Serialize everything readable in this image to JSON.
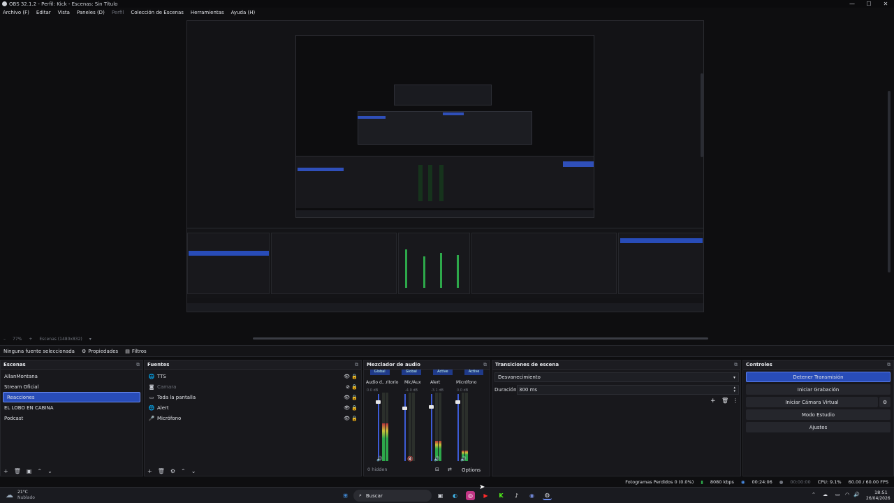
{
  "window": {
    "title": "OBS 32.1.2 - Perfil: Kick - Escenas: Sin Título"
  },
  "menu": [
    "Archivo (F)",
    "Editar",
    "Vista",
    "Paneles (D)",
    "Perfil",
    "Colección de Escenas",
    "Herramientas",
    "Ayuda (H)"
  ],
  "zoom": {
    "percent": "77%",
    "scale_label": "Escenas (1480x832)"
  },
  "source_bar": {
    "no_source": "Ninguna fuente seleccionada",
    "properties": "Propiedades",
    "filters": "Filtros"
  },
  "scenes": {
    "title": "Escenas",
    "items": [
      "AllanMontana",
      "Stream Oficial",
      "Reacciones",
      "EL LOBO EN CABINA",
      "Podcast"
    ],
    "selected": "Reacciones"
  },
  "sources": {
    "title": "Fuentes",
    "items": [
      {
        "name": "TTS",
        "icon": "globe-icon"
      },
      {
        "name": "Camara",
        "icon": "camera-icon"
      },
      {
        "name": "Toda la pantalla",
        "icon": "monitor-icon"
      },
      {
        "name": "Alert",
        "icon": "globe-icon"
      },
      {
        "name": "Micrófono",
        "icon": "mic-icon"
      }
    ]
  },
  "mixer": {
    "title": "Mezclador de audio",
    "tabs": [
      "Global",
      "Global",
      "Active",
      "Active"
    ],
    "channels": [
      {
        "name": "Audio d...ritorio",
        "db": "0.0 dB",
        "level": 0.55,
        "fader": 0.9
      },
      {
        "name": "Mic/Aux",
        "db": "-4.0 dB",
        "level": 0.0,
        "fader": 0.8
      },
      {
        "name": "Alert",
        "db": "-3.1 dB",
        "level": 0.3,
        "fader": 0.82
      },
      {
        "name": "Micrófono",
        "db": "0.0 dB",
        "level": 0.15,
        "fader": 0.9
      }
    ],
    "hidden": "0 hidden",
    "options": "Options"
  },
  "transitions": {
    "title": "Transiciones de escena",
    "selected": "Desvanecimiento",
    "duration_label": "Duración",
    "duration_value": "300 ms"
  },
  "controls": {
    "title": "Controles",
    "buttons": [
      "Detener Transmisión",
      "Iniciar Grabación",
      "Iniciar Cámara Virtual",
      "Modo Estudio",
      "Ajustes"
    ]
  },
  "status": {
    "dropped": "Fotogramas Perdidos 0 (0.0%)",
    "kbps": "8080 kbps",
    "stream_time": "00:24:06",
    "rec_time": "00:00:00",
    "cpu": "CPU: 9.1%",
    "fps": "60.00 / 60.00 FPS"
  },
  "taskbar": {
    "weather_temp": "21°C",
    "weather_desc": "Nublado",
    "search": "Buscar",
    "time": "18:51",
    "date": "26/04/2026"
  }
}
